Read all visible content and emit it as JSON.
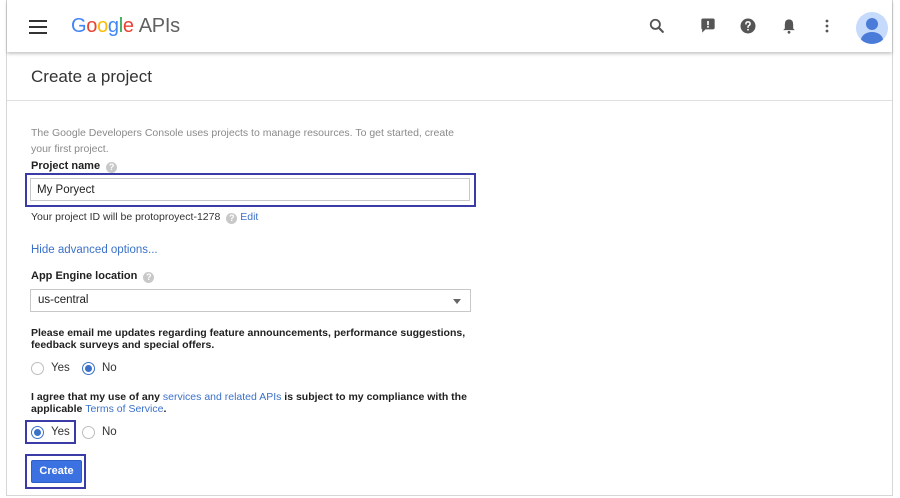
{
  "header": {
    "logo_parts": [
      "G",
      "o",
      "o",
      "g",
      "l",
      "e"
    ],
    "logo_suffix": "APIs"
  },
  "page": {
    "title": "Create a project",
    "intro": "The Google Developers Console uses projects to manage resources. To get started, create your first project."
  },
  "form": {
    "project_name_label": "Project name",
    "project_name_value": "My Poryect",
    "project_id_text": "Your project ID will be protoproyect-1278",
    "edit_link": "Edit",
    "advanced_link": "Hide advanced options...",
    "location_label": "App Engine location",
    "location_value": "us-central",
    "email_prompt": "Please email me updates regarding feature announcements, performance suggestions, feedback surveys and special offers.",
    "email_options": {
      "yes": "Yes",
      "no": "No",
      "selected": "No"
    },
    "terms_prefix": "I agree that my use of any ",
    "terms_link1": "services and related APIs",
    "terms_mid": " is subject to my compliance with the applicable ",
    "terms_link2": "Terms of Service",
    "terms_suffix": ".",
    "terms_options": {
      "yes": "Yes",
      "no": "No",
      "selected": "Yes"
    },
    "create_label": "Create"
  },
  "colors": {
    "accent": "#3b71e0",
    "link": "#3b71c9",
    "highlight": "#3b3ba8"
  },
  "icons": [
    "menu-icon",
    "search-icon",
    "feedback-icon",
    "help-icon",
    "notifications-icon",
    "more-vert-icon",
    "account-avatar"
  ]
}
